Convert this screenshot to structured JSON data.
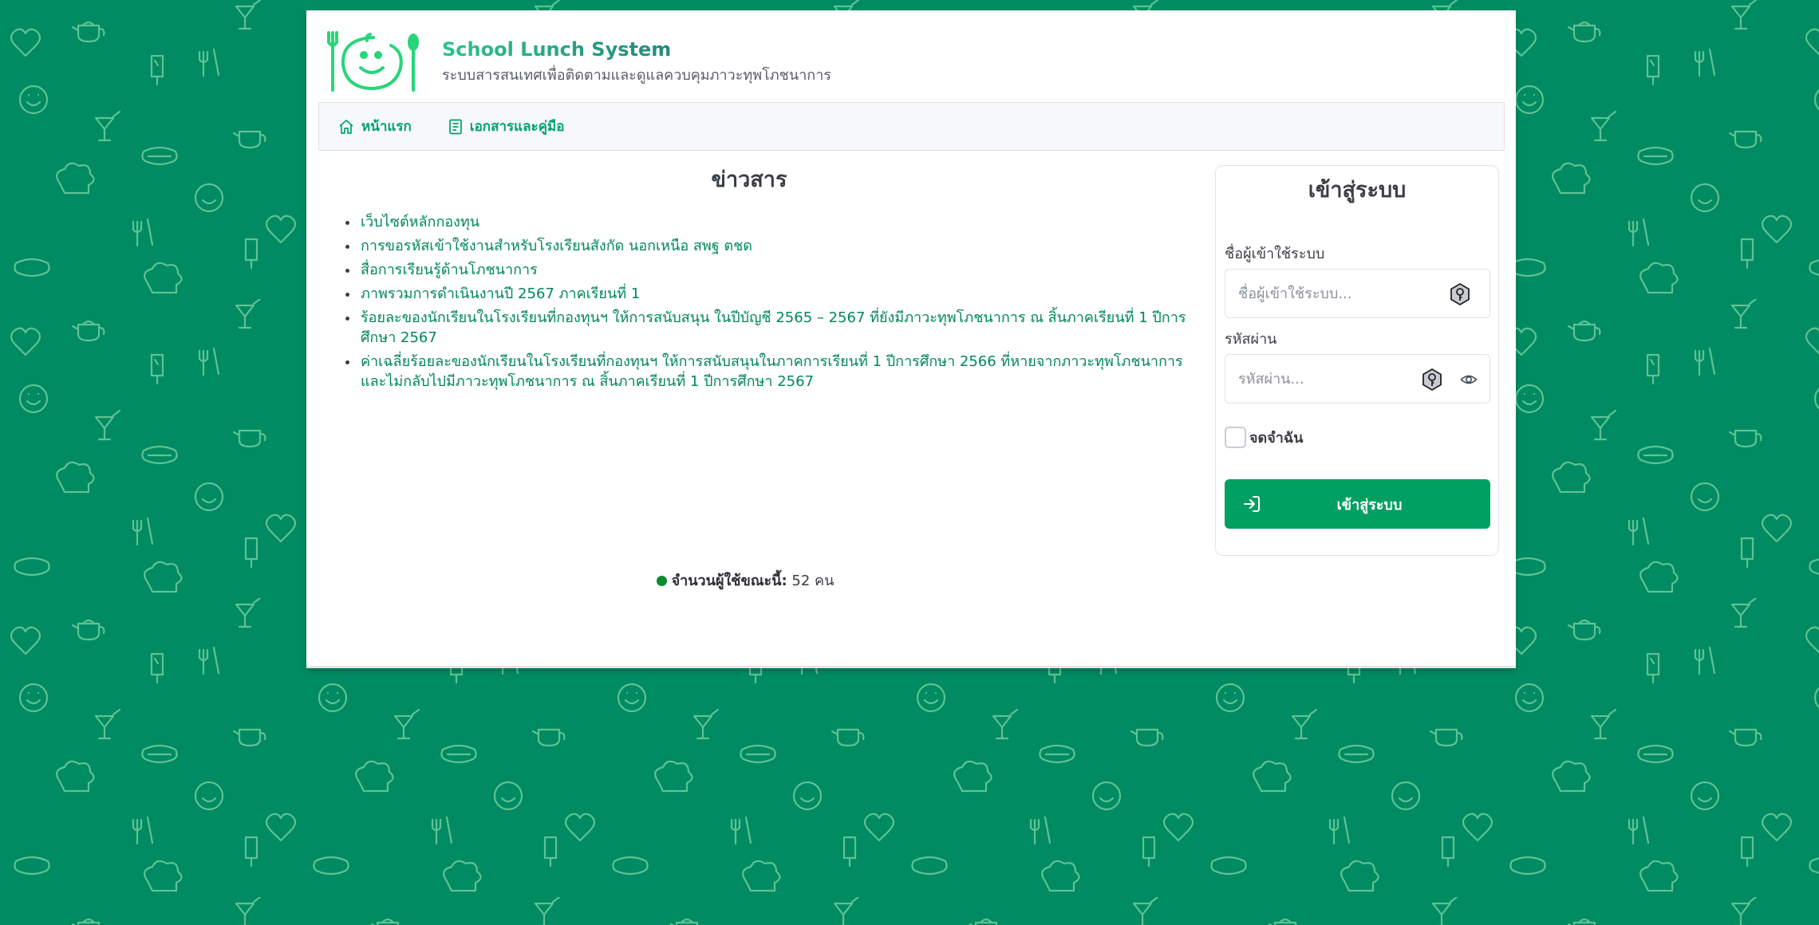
{
  "brand": {
    "title": "School Lunch System",
    "subtitle": "ระบบสารสนเทศเพื่อติดตามและดูแลควบคุมภาวะทุพโภชนาการ"
  },
  "nav": {
    "items": [
      {
        "label": "หน้าแรก",
        "icon": "home-icon"
      },
      {
        "label": "เอกสารและคู่มือ",
        "icon": "document-icon"
      }
    ]
  },
  "news": {
    "title": "ข่าวสาร",
    "items": [
      "เว็บไซต์หลักกองทุน",
      "การขอรหัสเข้าใช้งานสำหรับโรงเรียนสังกัด นอกเหนือ สพฐ ตชด",
      "สื่อการเรียนรู้ด้านโภชนาการ",
      "ภาพรวมการดำเนินงานปี 2567 ภาคเรียนที่ 1",
      "ร้อยละของนักเรียนในโรงเรียนที่กองทุนฯ ให้การสนับสนุน ในปีบัญชี 2565 – 2567 ที่ยังมีภาวะทุพโภชนาการ ณ สิ้นภาคเรียนที่ 1 ปีการศึกษา 2567",
      "ค่าเฉลี่ยร้อยละของนักเรียนในโรงเรียนที่กองทุนฯ ให้การสนับสนุนในภาคการเรียนที่ 1 ปีการศึกษา 2566 ที่หายจากภาวะทุพโภชนาการและไม่กลับไปมีภาวะทุพโภชนาการ ณ สิ้นภาคเรียนที่ 1 ปีการศึกษา 2567"
    ]
  },
  "online": {
    "label": "จำนวนผู้ใช้ขณะนี้:",
    "value": "52 คน"
  },
  "login": {
    "title": "เข้าสู่ระบบ",
    "username_label": "ชื่อผู้เข้าใช้ระบบ",
    "username_placeholder": "ชื่อผู้เข้าใช้ระบบ...",
    "username_value": "",
    "password_label": "รหัสผ่าน",
    "password_placeholder": "รหัสผ่าน...",
    "password_value": "",
    "remember_label": "จดจำฉัน",
    "remember_checked": false,
    "submit_label": "เข้าสู่ระบบ"
  },
  "colors": {
    "background": "#008b62",
    "accent": "#00a060",
    "link": "#00875a",
    "online_dot": "#0d8a2e"
  }
}
